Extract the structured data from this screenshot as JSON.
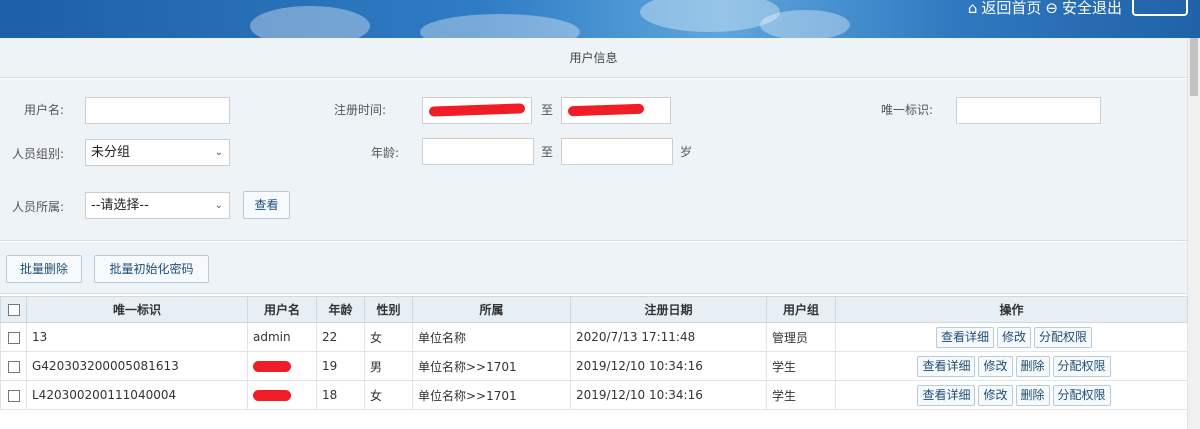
{
  "header": {
    "home_label": "返回首页",
    "logout_label": "安全退出",
    "colors": {
      "banner": "#2f7cc4",
      "redaction": "#f01c26"
    }
  },
  "page_title": "用户信息",
  "filters": {
    "username_label": "用户名:",
    "username_value": "",
    "register_time_label": "注册时间:",
    "to_label_1": "至",
    "unique_id_label": "唯一标识:",
    "unique_id_value": "",
    "group_label": "人员组别:",
    "group_selected": "未分组",
    "age_label": "年龄:",
    "age_from": "",
    "to_label_2": "至",
    "age_unit": "岁",
    "affiliation_label": "人员所属:",
    "affiliation_selected": "--请选择--",
    "search_button": "查看"
  },
  "actions": {
    "batch_delete": "批量删除",
    "batch_reset_password": "批量初始化密码"
  },
  "table": {
    "columns": [
      "唯一标识",
      "用户名",
      "年龄",
      "性别",
      "所属",
      "注册日期",
      "用户组",
      "操作"
    ],
    "rows": [
      {
        "id": "13",
        "username": "admin",
        "age": "22",
        "gender": "女",
        "affiliation": "单位名称",
        "date": "2020/7/13 17:11:48",
        "group": "管理员",
        "ops": [
          "查看详细",
          "修改",
          "分配权限"
        ]
      },
      {
        "id": "G420303200005081613",
        "username": "",
        "age": "19",
        "gender": "男",
        "affiliation": "单位名称>>1701",
        "date": "2019/12/10 10:34:16",
        "group": "学生",
        "ops": [
          "查看详细",
          "修改",
          "删除",
          "分配权限"
        ]
      },
      {
        "id": "L420300200111040004",
        "username": "",
        "age": "18",
        "gender": "女",
        "affiliation": "单位名称>>1701",
        "date": "2019/12/10 10:34:16",
        "group": "学生",
        "ops": [
          "查看详细",
          "修改",
          "删除",
          "分配权限"
        ]
      }
    ]
  }
}
